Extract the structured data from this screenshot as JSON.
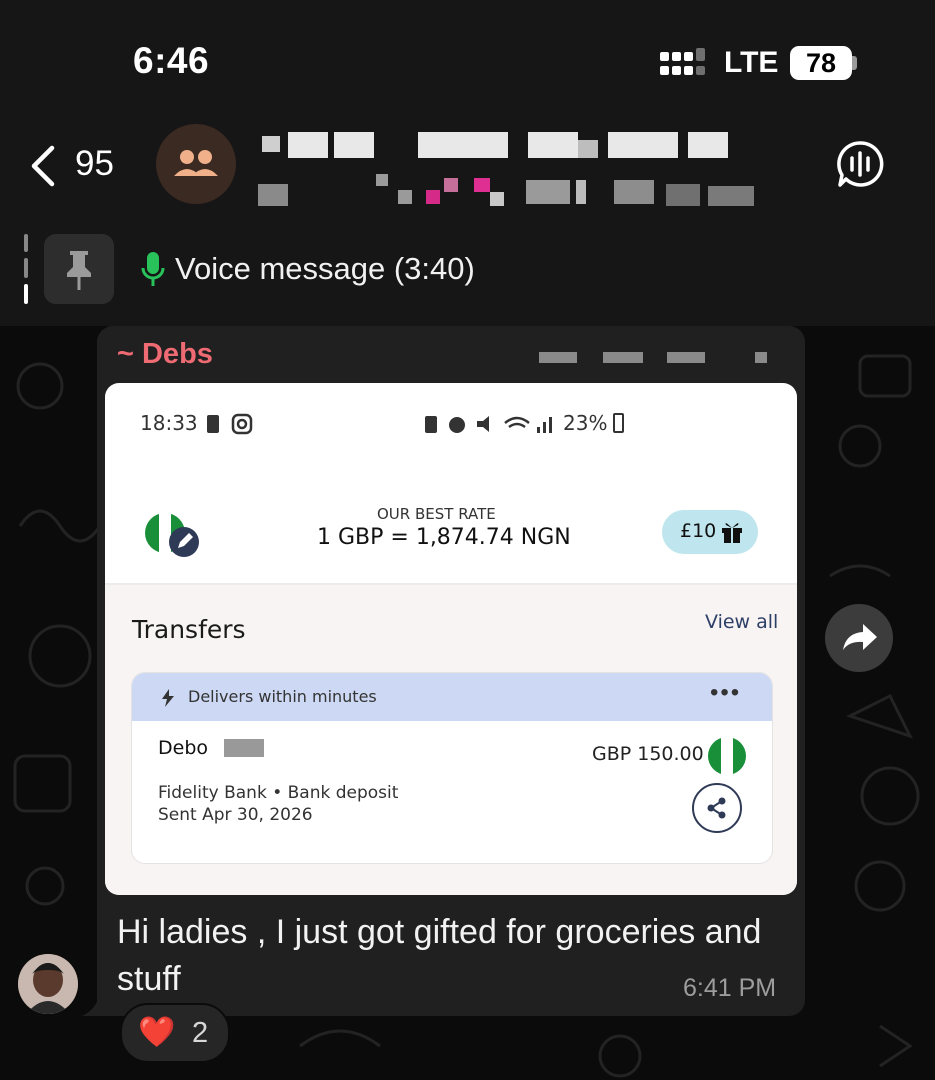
{
  "status_bar": {
    "time": "6:46",
    "network": "LTE",
    "battery": "78"
  },
  "header": {
    "unread_count": "95",
    "group_name": "[redacted]",
    "subtitle": "[redacted]"
  },
  "pinned": {
    "label": "Voice message (3:40)"
  },
  "message": {
    "sender": "~ Debs",
    "caption": "Hi ladies , I just got gifted for groceries and stuff",
    "time": "6:41 PM",
    "reaction": {
      "emoji": "❤️",
      "count": "2"
    }
  },
  "shared_screenshot": {
    "status_time": "18:33",
    "status_battery": "23%",
    "rate_label": "OUR BEST RATE",
    "rate": "1 GBP = 1,874.74 NGN",
    "gift_label": "£10",
    "transfers_title": "Transfers",
    "view_all": "View all",
    "transfer": {
      "banner": "Delivers within minutes",
      "recipient": "Debo",
      "amount": "GBP 150.00",
      "bank": "Fidelity Bank • Bank deposit",
      "sent": "Sent Apr 30, 2026"
    }
  },
  "colors": {
    "sender_name": "#ef6b73",
    "mic_green": "#29c15a",
    "bubble": "#202020",
    "background": "#0b0b0b"
  },
  "icons": [
    "back-chevron-icon",
    "group-avatar-icon",
    "voice-call-icon",
    "pin-icon",
    "mic-icon",
    "forward-icon",
    "heart-icon",
    "share-icon",
    "gift-icon"
  ]
}
